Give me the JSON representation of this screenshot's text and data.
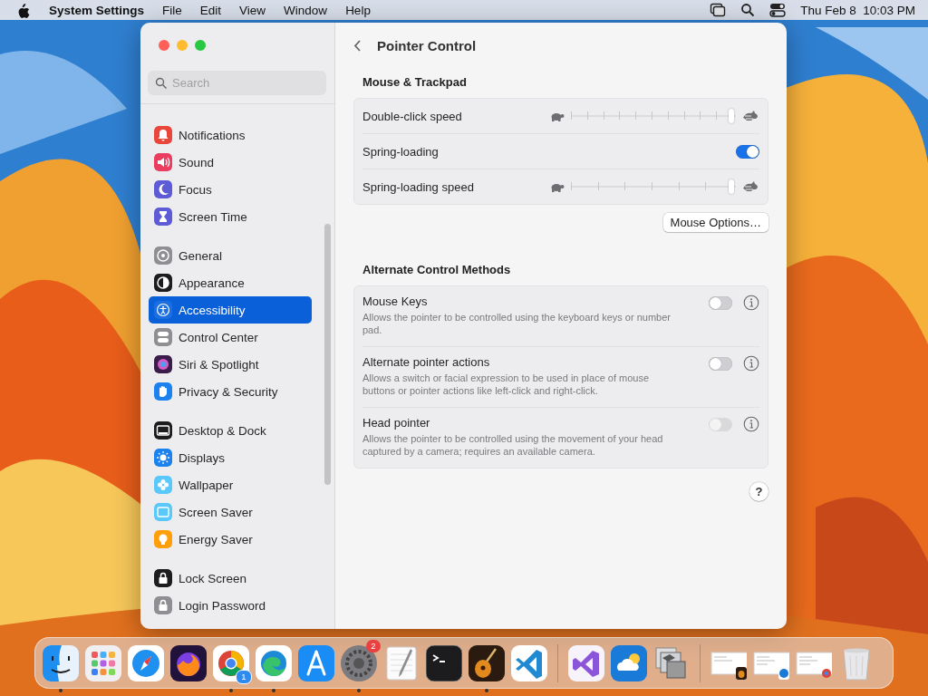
{
  "menu_bar": {
    "app_name": "System Settings",
    "menus": [
      "File",
      "Edit",
      "View",
      "Window",
      "Help"
    ],
    "clock": "Thu Feb 8  10:03 PM"
  },
  "window": {
    "title": "Pointer Control",
    "search": {
      "placeholder": "Search"
    },
    "sidebar": {
      "groups": [
        [
          {
            "label": "Notifications",
            "selected": false
          },
          {
            "label": "Sound",
            "selected": false
          },
          {
            "label": "Focus",
            "selected": false
          },
          {
            "label": "Screen Time",
            "selected": false
          }
        ],
        [
          {
            "label": "General",
            "selected": false
          },
          {
            "label": "Appearance",
            "selected": false
          },
          {
            "label": "Accessibility",
            "selected": true
          },
          {
            "label": "Control Center",
            "selected": false
          },
          {
            "label": "Siri & Spotlight",
            "selected": false
          },
          {
            "label": "Privacy & Security",
            "selected": false
          }
        ],
        [
          {
            "label": "Desktop & Dock",
            "selected": false
          },
          {
            "label": "Displays",
            "selected": false
          },
          {
            "label": "Wallpaper",
            "selected": false
          },
          {
            "label": "Screen Saver",
            "selected": false
          },
          {
            "label": "Energy Saver",
            "selected": false
          }
        ],
        [
          {
            "label": "Lock Screen",
            "selected": false
          },
          {
            "label": "Login Password",
            "selected": false
          }
        ]
      ]
    },
    "sections": [
      {
        "title": "Mouse & Trackpad",
        "rows": [
          {
            "kind": "slider",
            "label": "Double-click speed",
            "level": 0.97
          },
          {
            "kind": "toggle",
            "label": "Spring-loading",
            "on": true
          },
          {
            "kind": "slider",
            "label": "Spring-loading speed",
            "level": 0.97
          }
        ],
        "button": "Mouse Options…"
      },
      {
        "title": "Alternate Control Methods",
        "rows": [
          {
            "kind": "option",
            "label": "Mouse Keys",
            "description": "Allows the pointer to be controlled using the keyboard keys or number pad.",
            "on": false,
            "disabled": false
          },
          {
            "kind": "option",
            "label": "Alternate pointer actions",
            "description": "Allows a switch or facial expression to be used in place of mouse buttons or pointer actions like left-click and right-click.",
            "on": false,
            "disabled": false
          },
          {
            "kind": "option",
            "label": "Head pointer",
            "description": "Allows the pointer to be controlled using the movement of your head captured by a camera; requires an available camera.",
            "on": false,
            "disabled": true
          }
        ]
      }
    ],
    "help_button": "?"
  },
  "dock": {
    "items": [
      {
        "running": true
      },
      {
        "running": false
      },
      {
        "running": false
      },
      {
        "running": false
      },
      {
        "running": true,
        "badge": "1"
      },
      {
        "running": true
      },
      {
        "running": false
      },
      {
        "running": true,
        "badge": "2"
      },
      {
        "running": false
      },
      {
        "running": false
      },
      {
        "running": true
      },
      {
        "running": false
      },
      {
        "running": false
      },
      {
        "running": false
      },
      {
        "running": false
      },
      {
        "running": false
      },
      {
        "running": false
      },
      {
        "running": false
      },
      {
        "running": false
      }
    ]
  }
}
